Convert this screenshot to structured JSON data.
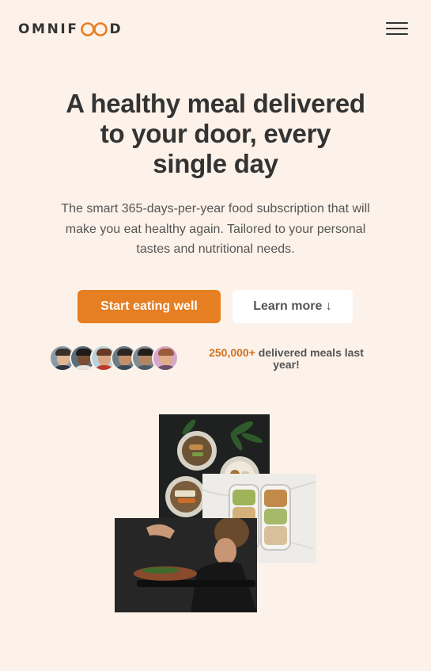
{
  "brand": {
    "name_start": "OMNIF",
    "name_end": "D",
    "accent": "#e67e22"
  },
  "nav": {
    "menu_icon": "hamburger-menu-icon"
  },
  "hero": {
    "title_lines": [
      "A healthy meal delivered",
      "to your door, every",
      "single day"
    ],
    "description_lines": [
      "The smart 365-days-per-year food subscription that will",
      "make you eat healthy again. Tailored to your personal",
      "tastes and nutritional needs."
    ],
    "cta_primary": "Start eating well",
    "cta_secondary": "Learn more ↓"
  },
  "delivered": {
    "count": "250,000+",
    "text_line1": " delivered meals last",
    "text_line2": "year!"
  },
  "colors": {
    "background": "#fdf2e9",
    "primary": "#e67e22",
    "text": "#333333"
  }
}
